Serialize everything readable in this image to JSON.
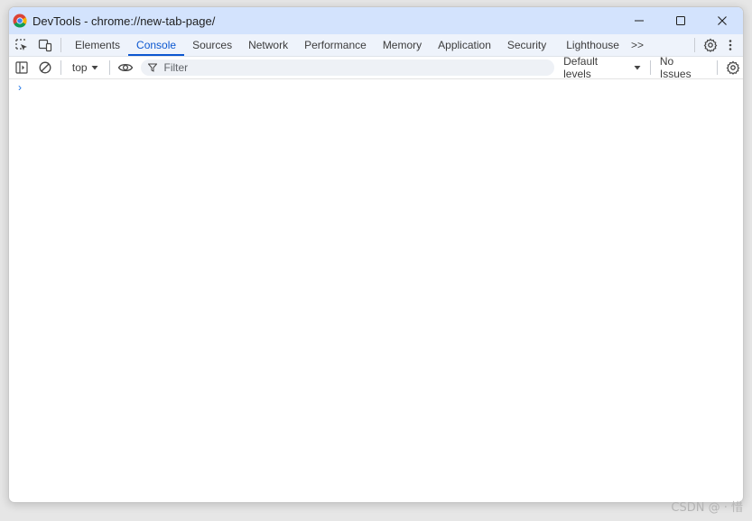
{
  "window": {
    "title": "DevTools - chrome://new-tab-page/",
    "controls": [
      "minimize-icon",
      "maximize-icon",
      "close-icon"
    ]
  },
  "tabbar": {
    "tabs": [
      {
        "label": "Elements"
      },
      {
        "label": "Console",
        "active": true
      },
      {
        "label": "Sources"
      },
      {
        "label": "Network"
      },
      {
        "label": "Performance"
      },
      {
        "label": "Memory"
      },
      {
        "label": "Application"
      },
      {
        "label": "Security"
      },
      {
        "label": "Lighthouse"
      }
    ],
    "more_label": ">>"
  },
  "toolbar": {
    "context_label": "top",
    "filter_placeholder": "Filter",
    "levels_label": "Default levels",
    "issues_label": "No Issues"
  },
  "console": {
    "prompt_symbol": "›"
  },
  "watermark": "CSDN @ · 惜",
  "colors": {
    "titlebar_bg": "#d3e3fd",
    "accent": "#0b57d0",
    "prompt": "#1a73e8"
  }
}
